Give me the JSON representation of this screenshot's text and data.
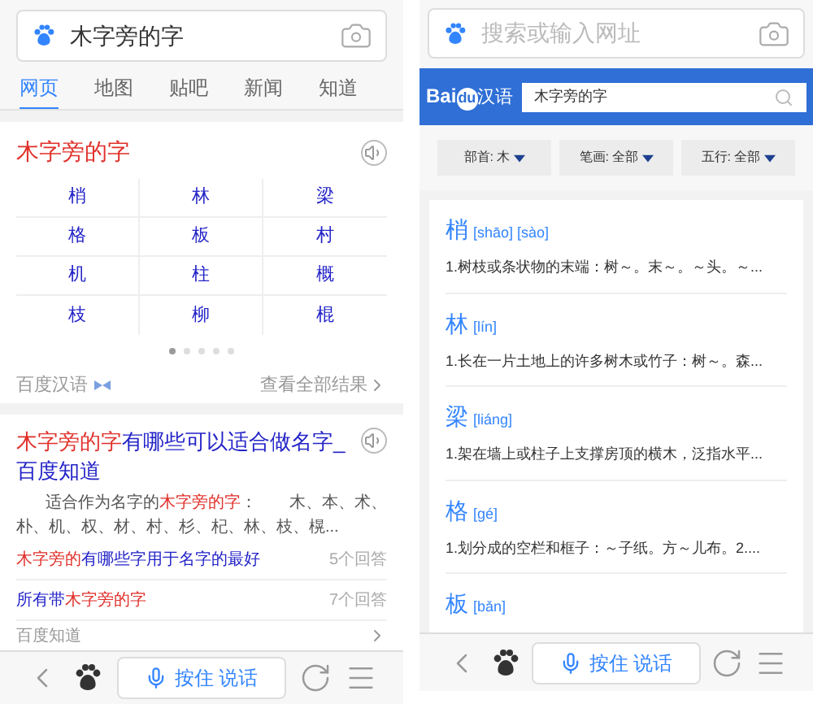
{
  "left_screen": {
    "search": {
      "value": "木字旁的字"
    },
    "tabs": [
      {
        "label": "网页",
        "selected": true
      },
      {
        "label": "地图",
        "selected": false
      },
      {
        "label": "贴吧",
        "selected": false
      },
      {
        "label": "新闻",
        "selected": false
      },
      {
        "label": "知道",
        "selected": false
      }
    ],
    "dictionary_card": {
      "title": "木字旁的字",
      "characters": [
        "梢",
        "林",
        "梁",
        "格",
        "板",
        "村",
        "机",
        "柱",
        "概",
        "枝",
        "柳",
        "棍"
      ],
      "pager": [
        {
          "selected": true
        },
        {
          "selected": false
        },
        {
          "selected": false
        },
        {
          "selected": false
        },
        {
          "selected": false
        }
      ],
      "source": "百度汉语",
      "more_link": "查看全部结果"
    },
    "answer_card": {
      "title": [
        {
          "text": "木字旁的字",
          "highlight": true
        },
        {
          "text": "有哪些可以适合做名字_百度知道",
          "highlight": false
        }
      ],
      "snippet": [
        {
          "text": "适合作为名字的",
          "highlight": false
        },
        {
          "text": "木字旁的字",
          "highlight": true
        },
        {
          "text": "：　　木、本、术、朴、机、权、材、村、杉、杞、林、枝、榥...",
          "highlight": false
        }
      ],
      "questions": [
        {
          "title": [
            {
              "text": "木字旁的",
              "highlight": true
            },
            {
              "text": "有哪些字用于名字的最好",
              "highlight": false
            }
          ],
          "count": "5个回答"
        },
        {
          "title": [
            {
              "text": "所有带",
              "highlight": false
            },
            {
              "text": "木字旁的字",
              "highlight": true
            }
          ],
          "count": "7个回答"
        }
      ],
      "source": "百度知道"
    },
    "toolbar": {
      "voice_button": "按住 说话"
    }
  },
  "right_screen": {
    "search": {
      "placeholder": "搜索或输入网址"
    },
    "header": {
      "logo": [
        "Bai",
        "du",
        "汉语"
      ],
      "search_value": "木字旁的字"
    },
    "filters": [
      "部首: 木",
      "笔画: 全部",
      "五行: 全部"
    ],
    "entries": [
      {
        "character": "梢",
        "pinyin": "[shāo] [sào]",
        "definition": "1.树枝或条状物的末端：树～。末～。～头。～..."
      },
      {
        "character": "林",
        "pinyin": "[lín]",
        "definition": "1.长在一片土地上的许多树木或竹子：树～。森..."
      },
      {
        "character": "梁",
        "pinyin": "[liáng]",
        "definition": "1.架在墙上或柱子上支撑房顶的横木，泛指水平..."
      },
      {
        "character": "格",
        "pinyin": "[gé]",
        "definition": "1.划分成的空栏和框子：～子纸。方～儿布。2...."
      },
      {
        "character": "板",
        "pinyin": "[bǎn]"
      }
    ],
    "toolbar": {
      "voice_button": "按住 说话"
    }
  }
}
